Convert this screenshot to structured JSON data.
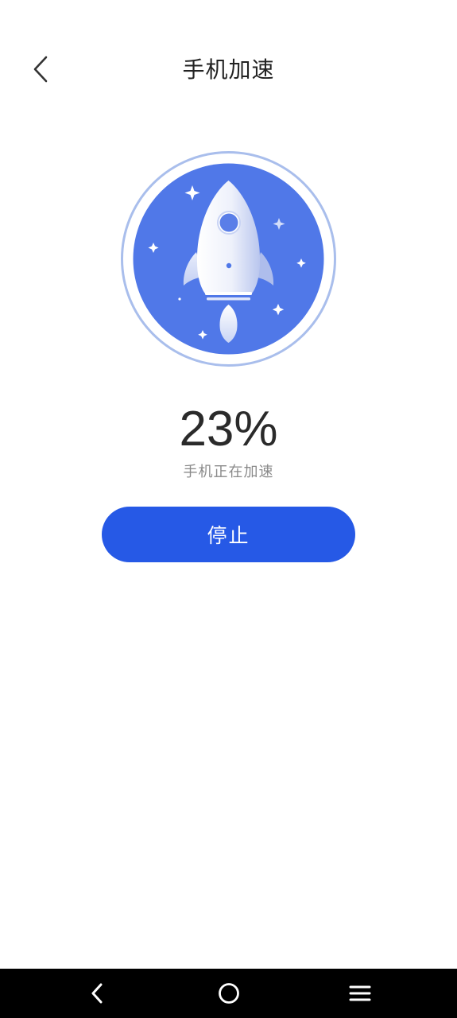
{
  "header": {
    "title": "手机加速",
    "back_icon": "chevron-left-icon"
  },
  "boost": {
    "progress_percent": 23,
    "percent_text": "23%",
    "status": "手机正在加速",
    "illustration_icon": "rocket-icon"
  },
  "actions": {
    "stop_label": "停止"
  },
  "system_nav": {
    "back_icon": "back-icon",
    "home_icon": "home-icon",
    "menu_icon": "menu-icon"
  },
  "colors": {
    "accent": "#2659E6",
    "badge_fill": "#5078E8",
    "badge_ring": "#A9BEEC",
    "title_text": "#222222",
    "status_text": "#8A8A8A",
    "nav_bar": "#000000"
  }
}
